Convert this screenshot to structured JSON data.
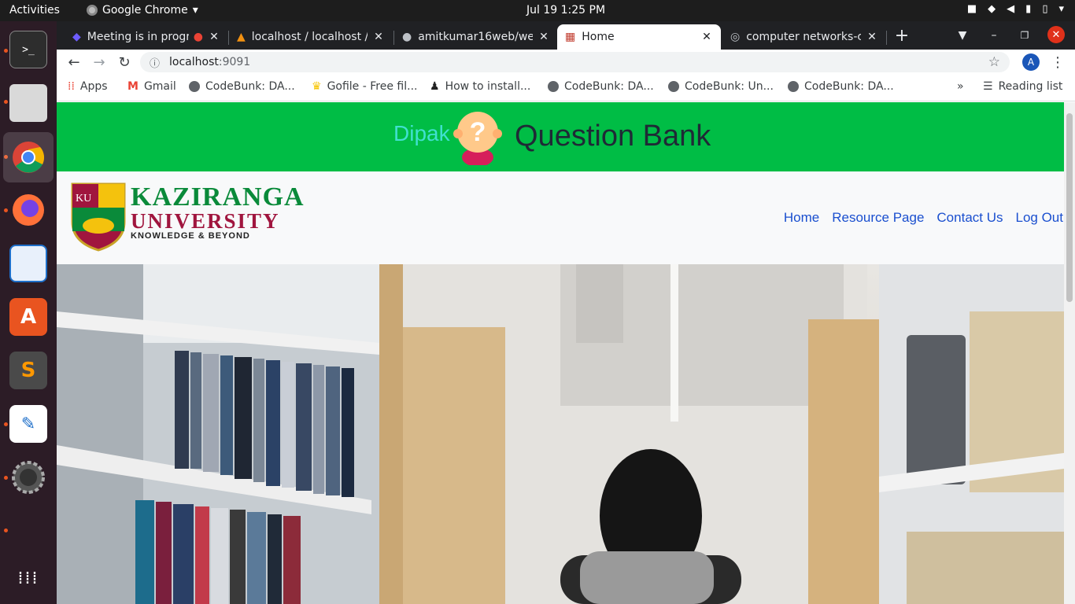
{
  "system": {
    "activities": "Activities",
    "app_name": "Google Chrome",
    "clock": "Jul 19  1:25 PM"
  },
  "tabs": [
    {
      "title": "Meeting is in progress",
      "active": false
    },
    {
      "title": "localhost / localhost / ",
      "active": false
    },
    {
      "title": "amitkumar16web/we",
      "active": false
    },
    {
      "title": "Home",
      "active": true
    },
    {
      "title": "computer networks-c",
      "active": false
    }
  ],
  "address_bar": {
    "host": "localhost",
    "port": ":9091"
  },
  "profile_initial": "A",
  "bookmarks": [
    {
      "label": "Apps"
    },
    {
      "label": "Gmail"
    },
    {
      "label": "CodeBunk: DA..."
    },
    {
      "label": "Gofile - Free fil..."
    },
    {
      "label": "How to install..."
    },
    {
      "label": "CodeBunk: DA..."
    },
    {
      "label": "CodeBunk: Un..."
    },
    {
      "label": "CodeBunk: DA..."
    }
  ],
  "reading_list": "Reading list",
  "site": {
    "brand_name": "Dipak",
    "brand_title": "Question Bank",
    "logo": {
      "badge": "KU",
      "name": "KAZIRANGA",
      "university": "UNIVERSITY",
      "tagline": "KNOWLEDGE & BEYOND"
    },
    "nav": [
      "Home",
      "Resource Page",
      "Contact Us",
      "Log Out"
    ]
  },
  "colors": {
    "banner": "#00bd45",
    "nav_link": "#1a4fcf",
    "brand_name": "#40e0d0"
  }
}
